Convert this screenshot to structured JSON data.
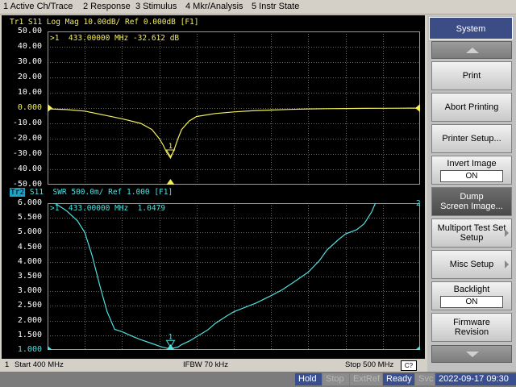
{
  "menu": [
    "1 Active Ch/Trace",
    "2 Response",
    "3 Stimulus",
    "4 Mkr/Analysis",
    "5 Instr State"
  ],
  "trace1": {
    "header": "Tr1 S11 Log Mag 10.00dB/ Ref 0.000dB [F1]",
    "marker_readout": ">1  433.00000 MHz -32.612 dB",
    "marker_label": "1",
    "color": "#f2ee5c",
    "y_ticks": [
      "50.00",
      "40.00",
      "30.00",
      "20.00",
      "10.00",
      "0.000",
      "-10.00",
      "-20.00",
      "-30.00",
      "-40.00",
      "-50.00"
    ],
    "ylim": [
      -50,
      50
    ],
    "ref_value": 0
  },
  "trace2": {
    "badge": "Tr2",
    "header": " S11  SWR 500.0m/ Ref 1.000 [F1]",
    "marker_readout": ">1  433.00000 MHz  1.0479",
    "marker_label": "1",
    "scale_label": "2",
    "color": "#4fe0e0",
    "y_ticks": [
      "6.000",
      "5.500",
      "5.000",
      "4.500",
      "4.000",
      "3.500",
      "3.000",
      "2.500",
      "2.000",
      "1.500",
      "1.000"
    ],
    "ylim": [
      1,
      6
    ],
    "ref_value": 1
  },
  "chart_data": {
    "type": "line",
    "x_range_mhz": [
      400,
      500
    ],
    "marker_x_mhz": 433,
    "series": [
      {
        "x": [
          400,
          405,
          410,
          415,
          420,
          425,
          428,
          430,
          431,
          432,
          433,
          434,
          435,
          436,
          438,
          440,
          445,
          450,
          455,
          460,
          465,
          470,
          475,
          480,
          485,
          490,
          495,
          500
        ],
        "values": [
          -0.5,
          -1.0,
          -2.0,
          -4.5,
          -7.0,
          -10.0,
          -14.0,
          -20.0,
          -24.0,
          -29.0,
          -32.612,
          -27.0,
          -20.0,
          -14.0,
          -8.5,
          -5.5,
          -3.6,
          -2.5,
          -1.8,
          -1.3,
          -0.9,
          -0.6,
          -0.4,
          -0.3,
          -0.2,
          -0.15,
          -0.1,
          -0.05
        ]
      },
      {
        "x": [
          400,
          402,
          405,
          408,
          410,
          412,
          414,
          416,
          418,
          420,
          423,
          425,
          428,
          430,
          431,
          432,
          433,
          434,
          435,
          436,
          438,
          440,
          443,
          445,
          448,
          450,
          453,
          456,
          460,
          463,
          466,
          470,
          473,
          475,
          478,
          480,
          483,
          485,
          487,
          488
        ],
        "values": [
          6.2,
          6.0,
          5.75,
          5.4,
          5.0,
          4.2,
          3.2,
          2.3,
          1.7,
          1.62,
          1.45,
          1.35,
          1.22,
          1.13,
          1.09,
          1.06,
          1.0479,
          1.07,
          1.1,
          1.18,
          1.3,
          1.45,
          1.68,
          1.9,
          2.15,
          2.3,
          2.45,
          2.6,
          2.85,
          3.05,
          3.3,
          3.65,
          4.05,
          4.4,
          4.75,
          4.95,
          5.1,
          5.3,
          5.7,
          6.0
        ]
      }
    ]
  },
  "bottom": {
    "channel": "1",
    "start": "Start 400 MHz",
    "ifbw": "IFBW 70 kHz",
    "stop": "Stop 500 MHz",
    "ch_badge": "C?"
  },
  "status": {
    "hold": "Hold",
    "stop": "Stop",
    "extref": "ExtRef",
    "ready": "Ready",
    "svc": "Svc",
    "datetime": "2022-09-17 09:30"
  },
  "softkeys": {
    "title": "System",
    "print": "Print",
    "abort_printing": "Abort Printing",
    "printer_setup": "Printer Setup...",
    "invert_image": "Invert Image",
    "invert_image_value": "ON",
    "dump_line1": "Dump",
    "dump_line2": "Screen Image...",
    "multiport_line1": "Multiport Test Set",
    "multiport_line2": "Setup",
    "misc_setup": "Misc Setup",
    "backlight": "Backlight",
    "backlight_value": "ON",
    "firmware_line1": "Firmware",
    "firmware_line2": "Revision"
  }
}
